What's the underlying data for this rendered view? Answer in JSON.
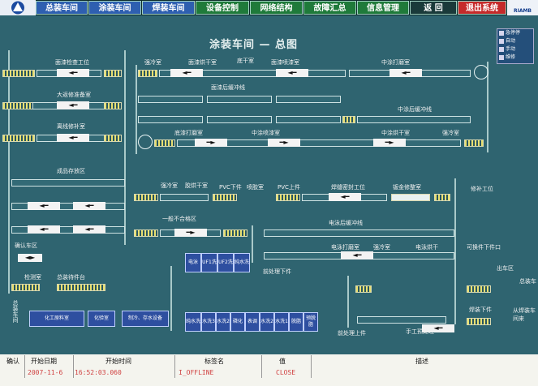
{
  "nav": {
    "buttons": [
      {
        "label": "总装车间",
        "style": "nav-blue"
      },
      {
        "label": "涂装车间",
        "style": "nav-blue"
      },
      {
        "label": "焊装车间",
        "style": "nav-blue"
      },
      {
        "label": "设备控制",
        "style": "nav-green"
      },
      {
        "label": "网络结构",
        "style": "nav-green"
      },
      {
        "label": "故障汇总",
        "style": "nav-green"
      },
      {
        "label": "信息管理",
        "style": "nav-green"
      },
      {
        "label": "返 回",
        "style": "nav-dark"
      },
      {
        "label": "退出系统",
        "style": "nav-red"
      }
    ],
    "brand": "RIAMB"
  },
  "title": "涂装车间 — 总图",
  "legend": [
    "急停停",
    "自动",
    "手动",
    "维修"
  ],
  "labels": {
    "l1": "面漆检查工位",
    "l2": "强冷室",
    "l3": "面漆烘干室",
    "l4": "底干室",
    "l5": "面漆喷漆室",
    "l6": "中涂打磨室",
    "l7": "大返修准备室",
    "l8": "面漆后缓冲线",
    "l9": "中涂后缓冲线",
    "l10": "离线修补室",
    "l11": "底漆打磨室",
    "l12": "中涂喷漆室",
    "l13": "中涂烘干室",
    "l14": "强冷室",
    "l15": "成品存放区",
    "l16": "强冷室",
    "l17": "胶烘干室",
    "l18": "PVC下件",
    "l19": "喷胶室",
    "l20": "PVC上件",
    "l21": "焊缝密封工位",
    "l22": "钣金修整室",
    "l23": "修补工位",
    "l24": "电泳后缓冲线",
    "l25": "可换件下件口",
    "l26": "电泳打磨室",
    "l27": "强冷室",
    "l28": "电泳烘干",
    "l29": "前处理下件",
    "l30": "出车区",
    "l31": "前处理上件",
    "l32": "手工预处理",
    "l33": "焊装下件",
    "l34": "从焊装车间来",
    "l35": "总装车",
    "l36": "确认车区",
    "l37": "电泳",
    "l38": "UF1洗",
    "l39": "UF2洗",
    "l40": "纯水洗",
    "l41": "纯水洗",
    "l42": "水洗3",
    "l43": "水洗2",
    "l44": "磷化",
    "l45": "表调",
    "l46": "水洗2",
    "l47": "水洗1",
    "l48": "脱脂",
    "l49": "预脱脂",
    "l50": "化工原料室",
    "l51": "化验室",
    "l52": "制冷、存水设备",
    "l53": "检测室",
    "l54": "总装车间",
    "l55": "一般不合格区",
    "l56": "总装待件台"
  },
  "alarm": {
    "headers": [
      "确认",
      "开始日期",
      "开始时间",
      "标签名",
      "值",
      "描述"
    ],
    "row": [
      "",
      "2007-11-6",
      "16:52:03.060",
      "I_OFFLINE",
      "CLOSE",
      ""
    ]
  }
}
